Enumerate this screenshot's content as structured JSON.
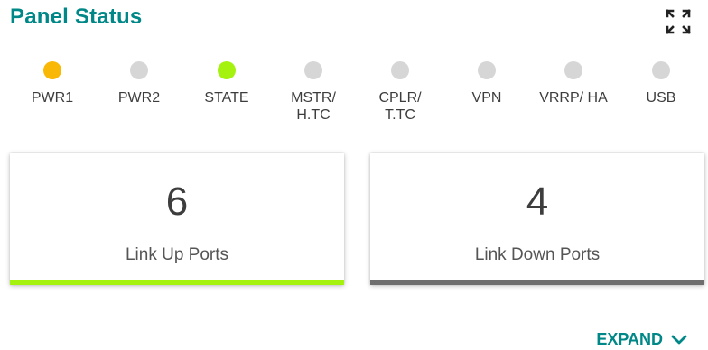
{
  "header": {
    "title": "Panel Status"
  },
  "leds": [
    {
      "label": "PWR1",
      "color": "#f9b806"
    },
    {
      "label": "PWR2",
      "color": "#d6d6d6"
    },
    {
      "label": "STATE",
      "color": "#a6f20f"
    },
    {
      "label": "MSTR/\nH.TC",
      "color": "#d6d6d6"
    },
    {
      "label": "CPLR/\nT.TC",
      "color": "#d6d6d6"
    },
    {
      "label": "VPN",
      "color": "#d6d6d6"
    },
    {
      "label": "VRRP/ HA",
      "color": "#d6d6d6"
    },
    {
      "label": "USB",
      "color": "#d6d6d6"
    }
  ],
  "cards": {
    "link_up": {
      "value": "6",
      "caption": "Link Up Ports",
      "accent": "#a6f20f"
    },
    "link_down": {
      "value": "4",
      "caption": "Link Down Ports",
      "accent": "#6e6e6e"
    }
  },
  "footer": {
    "expand_label": "EXPAND"
  },
  "icons": {
    "fullscreen": "fullscreen-icon",
    "expand": "chevron-down-icon"
  },
  "colors": {
    "accent": "#008787",
    "led_off": "#d6d6d6"
  }
}
